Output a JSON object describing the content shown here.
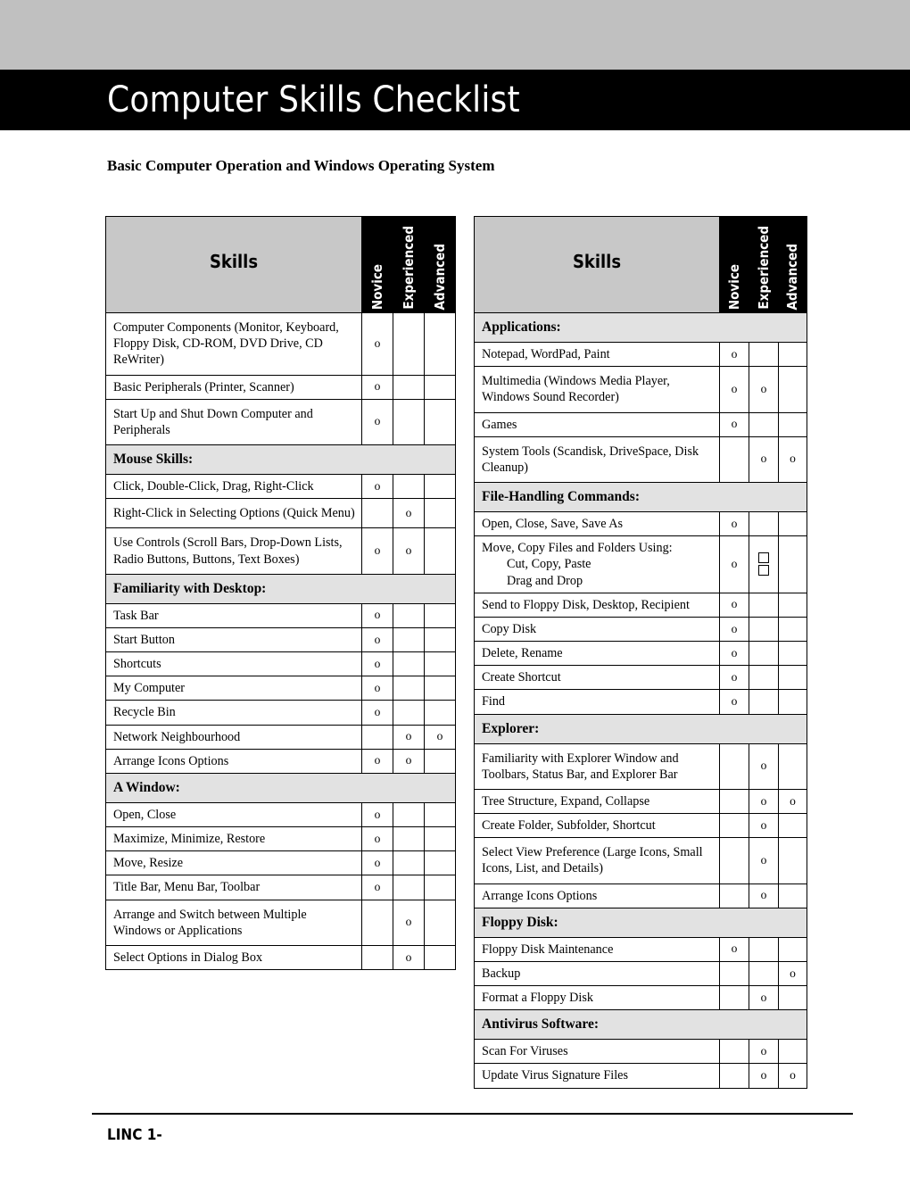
{
  "document": {
    "title": "Computer Skills Checklist",
    "subtitle": "Basic Computer Operation and Windows Operating System",
    "footer_label": "LINC 1-",
    "banner_color": "#000000",
    "top_band_color": "#c0c0c0",
    "header_cell_color": "#c8c8c8",
    "section_row_color": "#e2e2e2"
  },
  "columns": {
    "skills": "Skills",
    "novice": "Novice",
    "experienced": "Experienced",
    "advanced": "Advanced"
  },
  "marks": {
    "dot": "o",
    "empty": ""
  },
  "left_table": {
    "rows": [
      {
        "type": "skill",
        "label": "Computer Components (Monitor, Keyboard, Floppy Disk, CD-ROM, DVD Drive, CD ReWriter)",
        "novice": "o",
        "experienced": "",
        "advanced": ""
      },
      {
        "type": "skill",
        "label": "Basic Peripherals (Printer, Scanner)",
        "novice": "o",
        "experienced": "",
        "advanced": ""
      },
      {
        "type": "skill",
        "label": "Start Up and Shut Down Computer and Peripherals",
        "novice": "o",
        "experienced": "",
        "advanced": ""
      },
      {
        "type": "section",
        "label": "Mouse Skills:"
      },
      {
        "type": "skill",
        "label": "Click, Double-Click, Drag, Right-Click",
        "novice": "o",
        "experienced": "",
        "advanced": ""
      },
      {
        "type": "skill",
        "label": "Right-Click in Selecting Options (Quick Menu)",
        "novice": "",
        "experienced": "o",
        "advanced": ""
      },
      {
        "type": "skill",
        "label": "Use Controls (Scroll Bars, Drop-Down Lists, Radio Buttons, Buttons, Text Boxes)",
        "novice": "o",
        "experienced": "o",
        "advanced": ""
      },
      {
        "type": "section",
        "label": "Familiarity with Desktop:"
      },
      {
        "type": "skill",
        "label": "Task Bar",
        "novice": "o",
        "experienced": "",
        "advanced": ""
      },
      {
        "type": "skill",
        "label": "Start Button",
        "novice": "o",
        "experienced": "",
        "advanced": ""
      },
      {
        "type": "skill",
        "label": "Shortcuts",
        "novice": "o",
        "experienced": "",
        "advanced": ""
      },
      {
        "type": "skill",
        "label": "My Computer",
        "novice": "o",
        "experienced": "",
        "advanced": ""
      },
      {
        "type": "skill",
        "label": "Recycle Bin",
        "novice": "o",
        "experienced": "",
        "advanced": ""
      },
      {
        "type": "skill",
        "label": "Network Neighbourhood",
        "novice": "",
        "experienced": "o",
        "advanced": "o"
      },
      {
        "type": "skill",
        "label": "Arrange Icons Options",
        "novice": "o",
        "experienced": "o",
        "advanced": ""
      },
      {
        "type": "section",
        "label": "A Window:"
      },
      {
        "type": "skill",
        "label": "Open, Close",
        "novice": "o",
        "experienced": "",
        "advanced": ""
      },
      {
        "type": "skill",
        "label": "Maximize, Minimize, Restore",
        "novice": "o",
        "experienced": "",
        "advanced": ""
      },
      {
        "type": "skill",
        "label": "Move, Resize",
        "novice": "o",
        "experienced": "",
        "advanced": ""
      },
      {
        "type": "skill",
        "label": "Title Bar, Menu Bar, Toolbar",
        "novice": "o",
        "experienced": "",
        "advanced": ""
      },
      {
        "type": "skill",
        "label": "Arrange and Switch between Multiple Windows or Applications",
        "novice": "",
        "experienced": "o",
        "advanced": ""
      },
      {
        "type": "skill",
        "label": "Select Options in Dialog Box",
        "novice": "",
        "experienced": "o",
        "advanced": ""
      }
    ]
  },
  "right_table": {
    "rows": [
      {
        "type": "section",
        "label": "Applications:"
      },
      {
        "type": "skill",
        "label": "Notepad, WordPad, Paint",
        "novice": "o",
        "experienced": "",
        "advanced": ""
      },
      {
        "type": "skill",
        "label": "Multimedia (Windows Media Player, Windows Sound Recorder)",
        "novice": "o",
        "experienced": "o",
        "advanced": ""
      },
      {
        "type": "skill",
        "label": "Games",
        "novice": "o",
        "experienced": "",
        "advanced": ""
      },
      {
        "type": "skill",
        "label": "System Tools (Scandisk, DriveSpace, Disk Cleanup)",
        "novice": "",
        "experienced": "o",
        "advanced": "o"
      },
      {
        "type": "section",
        "label": "File-Handling Commands:"
      },
      {
        "type": "skill",
        "label": "Open, Close, Save, Save As",
        "novice": "o",
        "experienced": "",
        "advanced": ""
      },
      {
        "type": "skill_multiline",
        "label_lines": [
          "Move, Copy Files and Folders Using:",
          "Cut, Copy, Paste",
          "Drag and Drop"
        ],
        "novice": "o",
        "experienced": "checkbox-pair",
        "advanced": ""
      },
      {
        "type": "skill",
        "label": "Send to Floppy Disk, Desktop, Recipient",
        "novice": "o",
        "experienced": "",
        "advanced": ""
      },
      {
        "type": "skill",
        "label": "Copy Disk",
        "novice": "o",
        "experienced": "",
        "advanced": ""
      },
      {
        "type": "skill",
        "label": "Delete, Rename",
        "novice": "o",
        "experienced": "",
        "advanced": ""
      },
      {
        "type": "skill",
        "label": "Create Shortcut",
        "novice": "o",
        "experienced": "",
        "advanced": ""
      },
      {
        "type": "skill",
        "label": "Find",
        "novice": "o",
        "experienced": "",
        "advanced": ""
      },
      {
        "type": "section",
        "label": "Explorer:"
      },
      {
        "type": "skill",
        "label": "Familiarity with Explorer Window and Toolbars, Status Bar, and Explorer Bar",
        "novice": "",
        "experienced": "o",
        "advanced": ""
      },
      {
        "type": "skill",
        "label": "Tree Structure, Expand, Collapse",
        "novice": "",
        "experienced": "o",
        "advanced": "o"
      },
      {
        "type": "skill",
        "label": "Create Folder, Subfolder, Shortcut",
        "novice": "",
        "experienced": "o",
        "advanced": ""
      },
      {
        "type": "skill",
        "label": "Select View Preference (Large Icons, Small Icons, List, and Details)",
        "novice": "",
        "experienced": "o",
        "advanced": ""
      },
      {
        "type": "skill",
        "label": "Arrange Icons Options",
        "novice": "",
        "experienced": "o",
        "advanced": ""
      },
      {
        "type": "section",
        "label": "Floppy Disk:"
      },
      {
        "type": "skill",
        "label": "Floppy Disk Maintenance",
        "novice": "o",
        "experienced": "",
        "advanced": ""
      },
      {
        "type": "skill",
        "label": "Backup",
        "novice": "",
        "experienced": "",
        "advanced": "o"
      },
      {
        "type": "skill",
        "label": "Format a Floppy Disk",
        "novice": "",
        "experienced": "o",
        "advanced": ""
      },
      {
        "type": "section",
        "label": "Antivirus Software:"
      },
      {
        "type": "skill",
        "label": "Scan For Viruses",
        "novice": "",
        "experienced": "o",
        "advanced": ""
      },
      {
        "type": "skill",
        "label": "Update Virus Signature Files",
        "novice": "",
        "experienced": "o",
        "advanced": "o"
      }
    ]
  }
}
